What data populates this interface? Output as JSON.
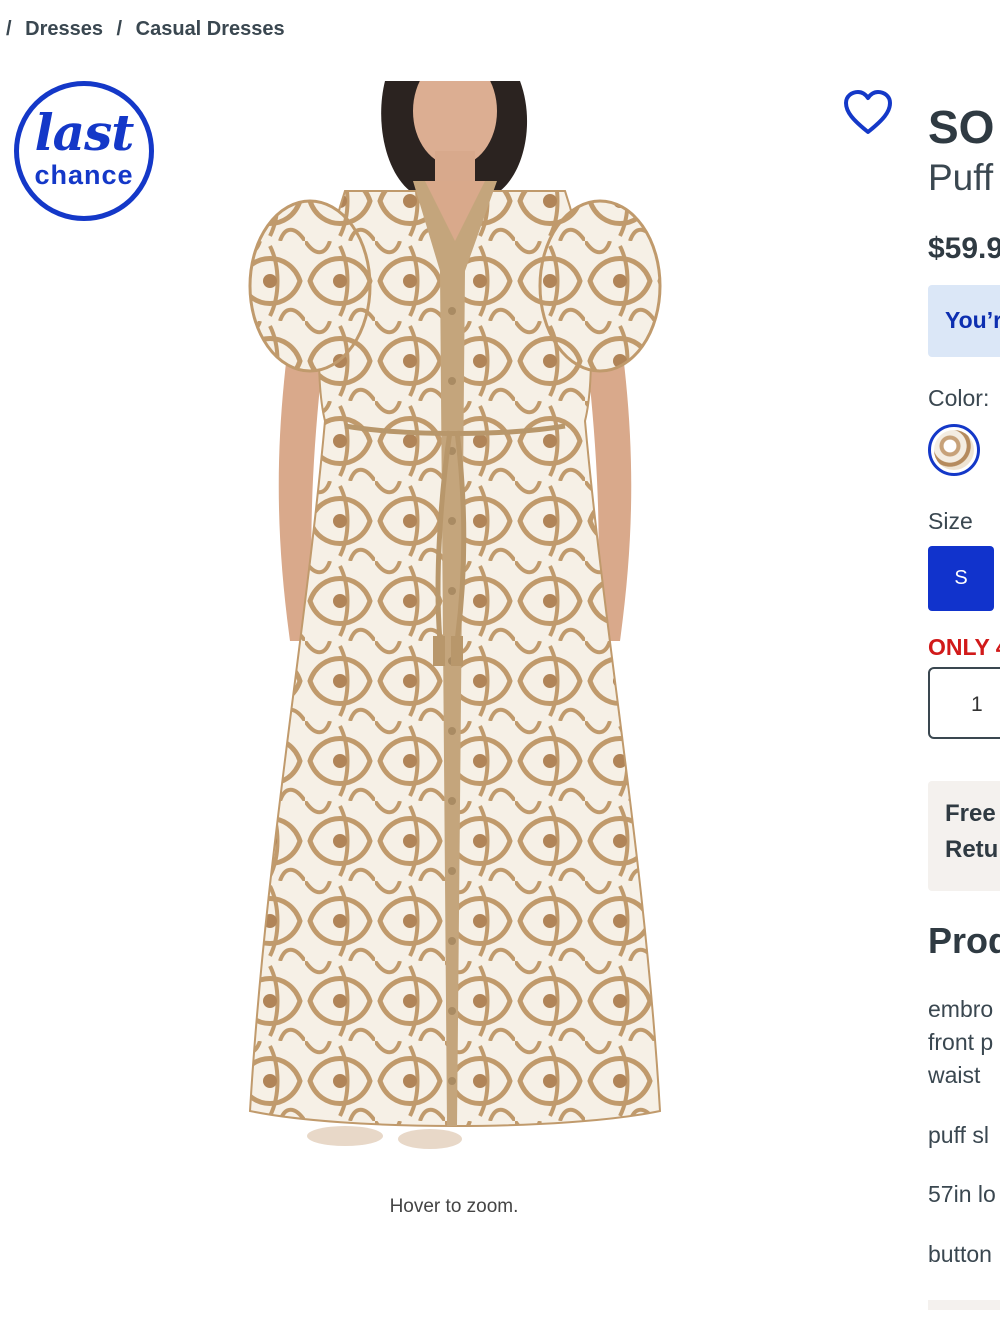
{
  "breadcrumb": {
    "sep": "/",
    "items": [
      "Dresses",
      "Casual Dresses"
    ]
  },
  "badge": {
    "line1": "last",
    "line2": "chance"
  },
  "image": {
    "hint": "Hover to zoom."
  },
  "product": {
    "brand": "SO",
    "title": "Puff",
    "price": "$59.9",
    "promo": "You’r",
    "color_label": "Color:",
    "size_label": "Size",
    "size_selected": "S",
    "stock": "ONLY 4",
    "quantity": "1",
    "shipping_line1": "Free",
    "shipping_line2": "Retu",
    "details_heading": "Prod",
    "details": [
      "embro",
      "front p",
      "waist",
      "puff sl",
      "57in lo",
      "button"
    ]
  },
  "colors": {
    "accent": "#1438c8",
    "alert": "#d11a1a",
    "text": "#2f3a42"
  }
}
